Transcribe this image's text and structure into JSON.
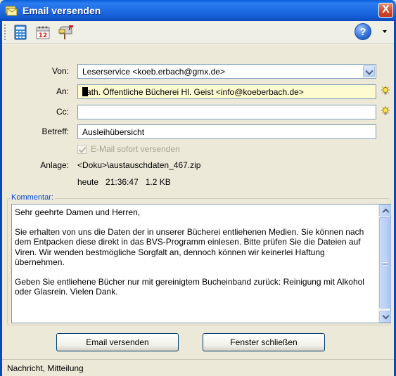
{
  "window": {
    "title": "Email versenden",
    "close_label": "X"
  },
  "toolbar": {
    "help_label": "?"
  },
  "form": {
    "from_label": "Von:",
    "from_value": "Leserservice <koeb.erbach@gmx.de>",
    "to_label": "An:",
    "to_value": "ath. Öffentliche Bücherei Hl. Geist <info@koeberbach.de>",
    "cc_label": "Cc:",
    "cc_value": "",
    "subject_label": "Betreff:",
    "subject_value": "Ausleihübersicht",
    "send_now_label": "E-Mail sofort versenden",
    "send_now_checked": true,
    "attachment_label": "Anlage:",
    "attachment_value": "<Doku>\\austauschdaten_467.zip",
    "attachment_meta": "heute   21:36:47   1.2 KB"
  },
  "comment": {
    "legend": "Kommentar:",
    "paragraphs": [
      "Sehr geehrte Damen und Herren,",
      "Sie erhalten von uns die Daten der in unserer Bücherei entliehenen Medien. Sie können nach dem Entpacken diese direkt in das BVS-Programm einlesen. Bitte prüfen Sie die Dateien auf Viren. Wir wenden bestmögliche Sorgfalt an, dennoch können wir keinerlei Haftung übernehmen.",
      "Geben Sie entliehene Bücher nur mit gereinigtem Bucheinband zurück: Reinigung mit Alkohol oder Glasrein. Vielen Dank."
    ]
  },
  "buttons": {
    "send": "Email versenden",
    "close": "Fenster schließen"
  },
  "status": {
    "text": "Nachricht, Mitteilung"
  }
}
